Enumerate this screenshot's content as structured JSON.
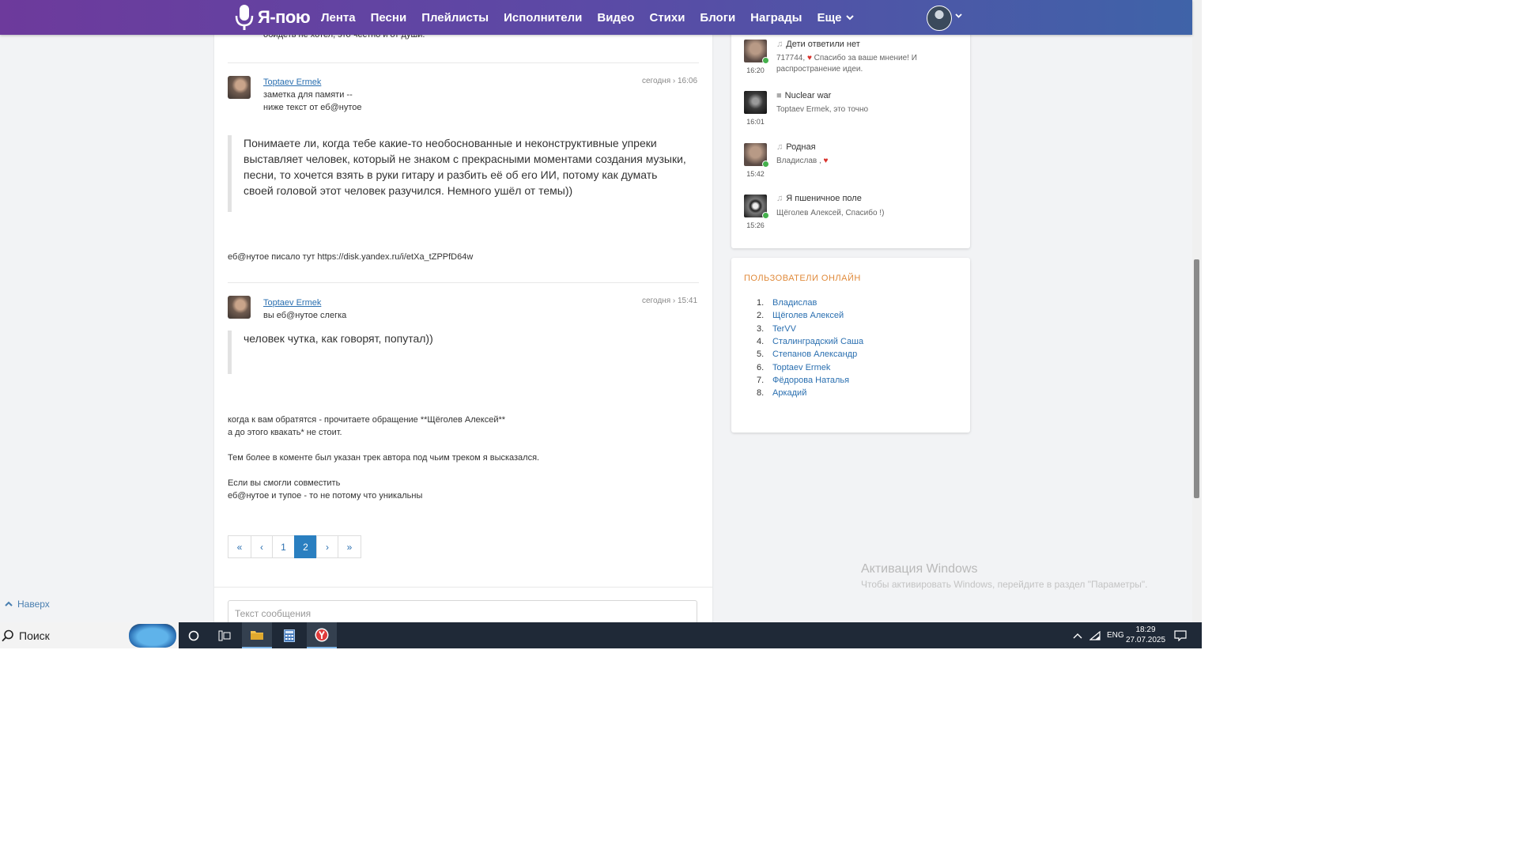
{
  "nav": {
    "logo": "Я-пою",
    "items": [
      "Лента",
      "Песни",
      "Плейлисты",
      "Исполнители",
      "Видео",
      "Стихи",
      "Блоги",
      "Награды"
    ],
    "more": "Еще"
  },
  "thread": {
    "cut_text": "обидеть не хотел, это честно и от души.",
    "posts": [
      {
        "author": "Toptaev Ermek",
        "time": "сегодня › 16:06",
        "lines": [
          "заметка для памяти --",
          "ниже текст от еб@нутое"
        ],
        "quote": "Понимаете ли, когда тебе какие-то необоснованные и неконструктивные упреки выставляет человек, который не знаком с прекрасными моментами создания музыки, песни, то хочется взять в руки гитару и разбить её об его ИИ, потому как думать своей головой этот человек разучился. Немного ушёл от темы))",
        "after": "еб@нутое писало тут https://disk.yandex.ru/i/etXa_tZPPfD64w"
      },
      {
        "author": "Toptaev Ermek",
        "time": "сегодня › 15:41",
        "lines": [
          "вы еб@нутое слегка"
        ],
        "quote": "человек чутка, как говорят, попутал))",
        "after": "когда к вам обратятся - прочитаете обращение **Щёголев Алексей**\nа до этого квакать* не стоит.\n\nТем более в коменте был указан трек автора под чьим треком я высказался.\n\nЕсли вы смогли совместить\nеб@нутое и тупое - то не потому что уникальны"
      }
    ],
    "pagination": [
      "«",
      "‹",
      "1",
      "2",
      "›",
      "»"
    ],
    "active_page": "2",
    "message_placeholder": "Текст сообщения"
  },
  "activity": [
    {
      "time": "16:20",
      "type": "music-note-icon",
      "title": "Дети ответили нет",
      "text_before": "717744,",
      "text_after": "Спасибо за ваше мнение! И распространение идеи.",
      "heart": true,
      "online": true
    },
    {
      "time": "16:01",
      "type": "video-icon",
      "title": "Nuclear war",
      "text_before": "Toptaev Ermek, это точно",
      "text_after": "",
      "heart": false,
      "online": false
    },
    {
      "time": "15:42",
      "type": "music-note-icon",
      "title": "Родная",
      "text_before": "Владислав ,",
      "text_after": "",
      "heart": true,
      "online": true
    },
    {
      "time": "15:26",
      "type": "music-note-icon",
      "title": "Я пшеничное поле",
      "text_before": "Щёголев Алексей, Спасибо !)",
      "text_after": "",
      "heart": false,
      "online": true
    }
  ],
  "online_users": {
    "title": "ПОЛЬЗОВАТЕЛИ ОНЛАЙН",
    "users": [
      "Владислав",
      "Щёголев Алексей",
      "TerVV",
      "Сталинградский Саша",
      "Степанов Александр",
      "Toptaev Ermek",
      "Фёдорова Наталья",
      "Аркадий"
    ]
  },
  "to_top": "Наверх",
  "watermark": {
    "line1": "Активация Windows",
    "line2": "Чтобы активировать Windows, перейдите в раздел \"Параметры\"."
  },
  "taskbar": {
    "search": "Поиск",
    "lang": "ENG",
    "time": "18:29",
    "date": "27.07.2025"
  },
  "colors": {
    "nav_gradient": [
      "#6d3a9c",
      "#3f63a8"
    ],
    "link": "#2a6fb0",
    "active_page": "#2a7fc0",
    "online_title": "#e08a3b",
    "online_dot": "#44b04c",
    "heart": "#d9302a"
  }
}
